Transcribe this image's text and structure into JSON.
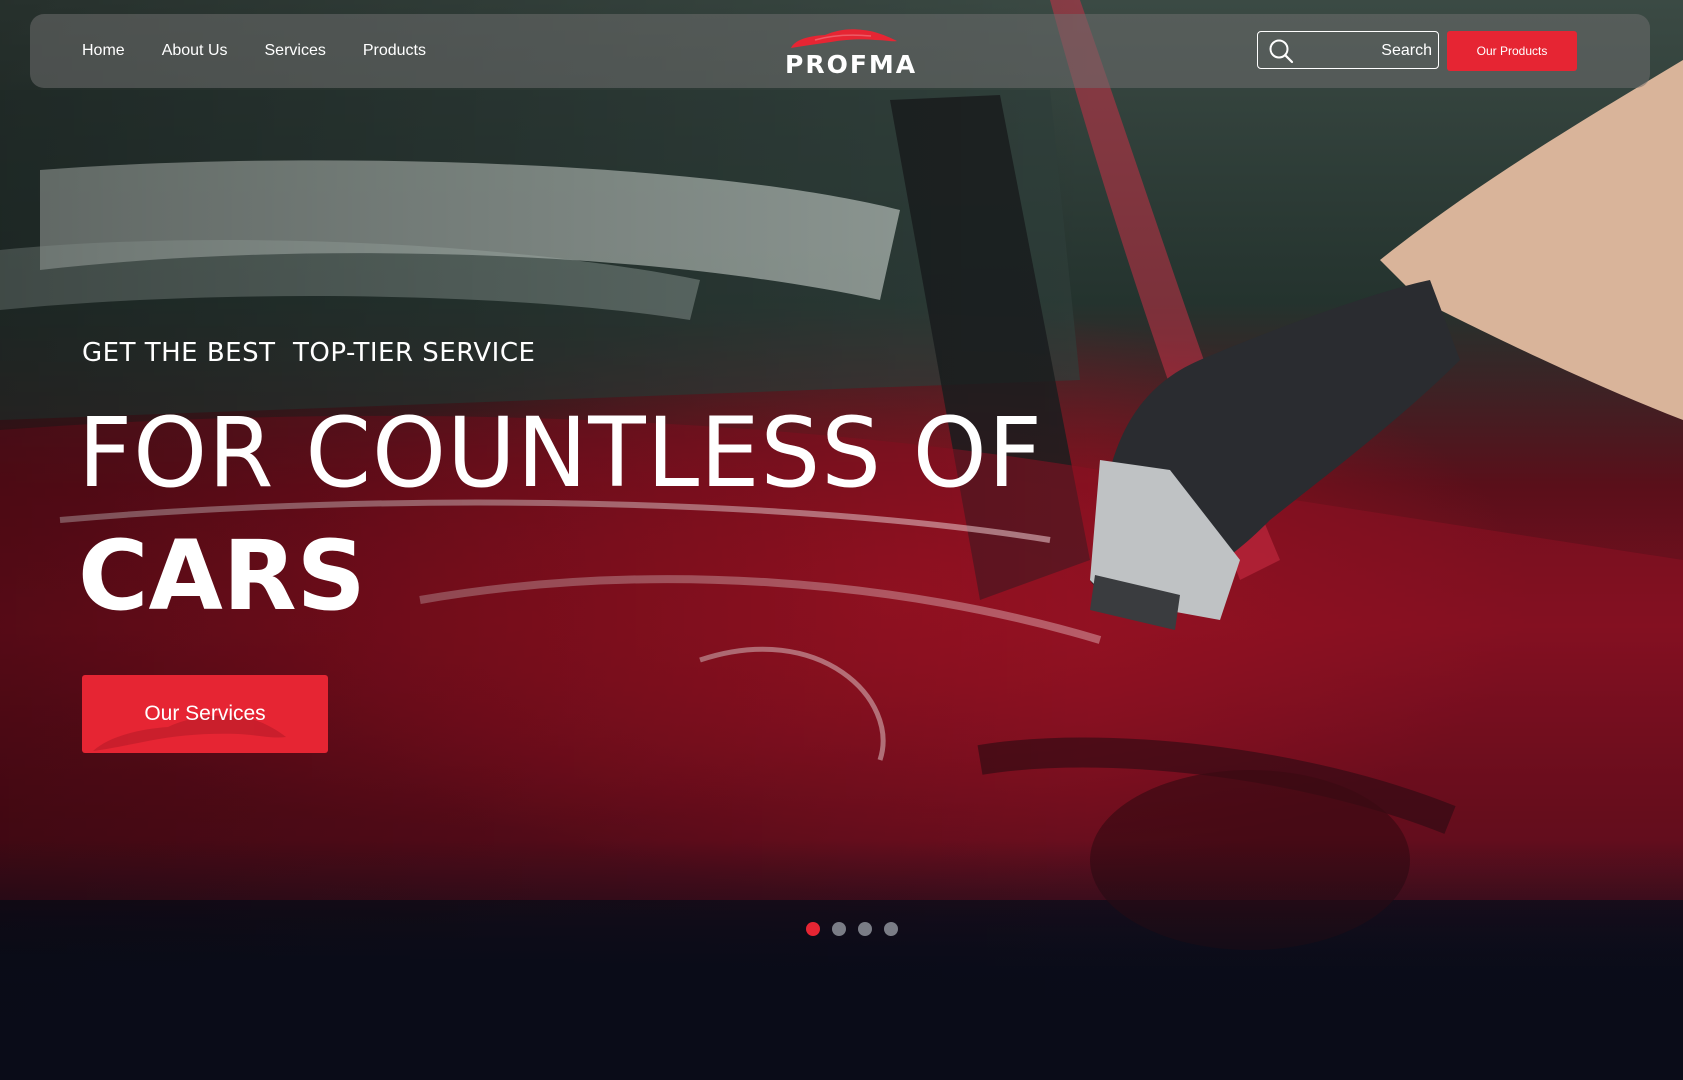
{
  "brand": {
    "name": "PROFMA",
    "accent_color": "#e62533"
  },
  "nav": {
    "links": [
      {
        "label": "Home"
      },
      {
        "label": "About Us"
      },
      {
        "label": "Services"
      },
      {
        "label": "Products"
      }
    ]
  },
  "search": {
    "placeholder": "Search",
    "icon": "search-icon"
  },
  "header_cta": {
    "label": "Our Products"
  },
  "hero": {
    "kicker": "GET THE BEST  TOP-TIER SERVICE",
    "headline_light": "FOR COUNTLESS OF",
    "headline_bold": "CARS",
    "cta_label": "Our Services",
    "background": "red car being polished by gloved hand"
  },
  "slider": {
    "total": 4,
    "active_index": 0
  }
}
